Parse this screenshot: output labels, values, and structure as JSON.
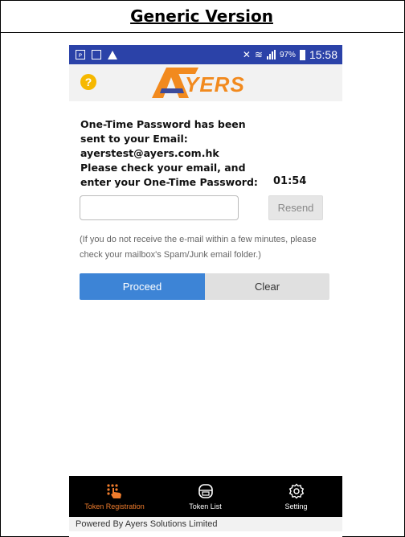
{
  "doc_header": {
    "title": "Generic Version"
  },
  "status_bar": {
    "signal_text": "97%",
    "time": "15:58"
  },
  "app_bar": {
    "help_label": "?",
    "logo_text": "YERS"
  },
  "message": {
    "lines": [
      "One-Time Password has been",
      "sent to your Email:",
      "ayerstest@ayers.com.hk",
      "Please check your email, and",
      "enter your One-Time Password:"
    ],
    "timer": "01:54"
  },
  "otp_input": {
    "value": "",
    "placeholder": ""
  },
  "resend_label": "Resend",
  "note": "(If you do not receive the e-mail within a few minutes, please check your mailbox's Spam/Junk email folder.)",
  "actions": {
    "proceed_label": "Proceed",
    "clear_label": "Clear"
  },
  "tabs": [
    {
      "label": "Token Registration",
      "icon": "hand-pointer-icon",
      "active": true
    },
    {
      "label": "Token List",
      "icon": "token-device-icon",
      "active": false
    },
    {
      "label": "Setting",
      "icon": "gear-icon",
      "active": false
    }
  ],
  "footer": "Powered By Ayers Solutions Limited",
  "colors": {
    "status_bar": "#2b42a8",
    "brand_orange": "#f28a1e",
    "proceed": "#3d84d6",
    "active_tab": "#ef7c2c"
  }
}
